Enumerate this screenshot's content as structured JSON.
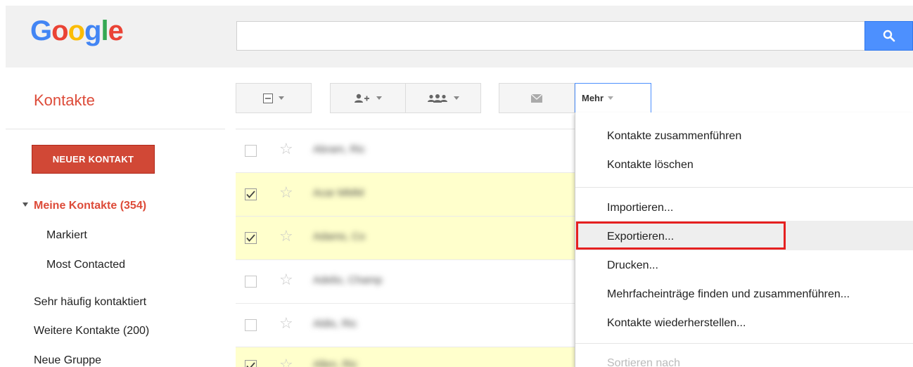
{
  "header": {
    "logo_letters": [
      {
        "char": "G",
        "color": "#4285f4"
      },
      {
        "char": "o",
        "color": "#ea4335"
      },
      {
        "char": "o",
        "color": "#fbbc05"
      },
      {
        "char": "g",
        "color": "#4285f4"
      },
      {
        "char": "l",
        "color": "#34a853"
      },
      {
        "char": "e",
        "color": "#ea4335"
      }
    ],
    "search_value": "",
    "search_icon": "search-icon"
  },
  "app": {
    "title": "Kontakte"
  },
  "toolbar": {
    "mehr_label": "Mehr",
    "select_icon": "select-checkbox-icon",
    "add_contact_icon": "add-person-icon",
    "group_icon": "group-icon",
    "mail_icon": "mail-icon"
  },
  "sidebar": {
    "new_contact_label": "NEUER KONTAKT",
    "items": [
      {
        "label": "Meine Kontakte (354)",
        "active": true
      },
      {
        "label": "Markiert"
      },
      {
        "label": "Most Contacted"
      },
      {
        "label": "Sehr häufig kontaktiert"
      },
      {
        "label": "Weitere Kontakte (200)"
      },
      {
        "label": "Neue Gruppe"
      }
    ]
  },
  "contacts": [
    {
      "name": "Abram, Ric",
      "checked": false
    },
    {
      "name": "Acar MMM",
      "checked": true
    },
    {
      "name": "Adams, Co",
      "checked": true
    },
    {
      "name": "Adelio, Champ",
      "checked": false
    },
    {
      "name": "Aldis, Ric",
      "checked": false
    },
    {
      "name": "Allen, Ric",
      "checked": true
    }
  ],
  "menu": {
    "items": [
      {
        "label": "Kontakte zusammenführen"
      },
      {
        "label": "Kontakte löschen"
      },
      {
        "label": "Importieren..."
      },
      {
        "label": "Exportieren...",
        "highlighted": true
      },
      {
        "label": "Drucken..."
      },
      {
        "label": "Mehrfacheinträge finden und zusammenführen..."
      },
      {
        "label": "Kontakte wiederherstellen..."
      },
      {
        "label": "Sortieren nach",
        "disabled": true
      }
    ]
  },
  "colors": {
    "accent_red": "#dd4b39",
    "button_red": "#d14836",
    "search_blue": "#4d90fe",
    "selected_row": "#ffffcc",
    "highlight_box": "#e52020"
  }
}
